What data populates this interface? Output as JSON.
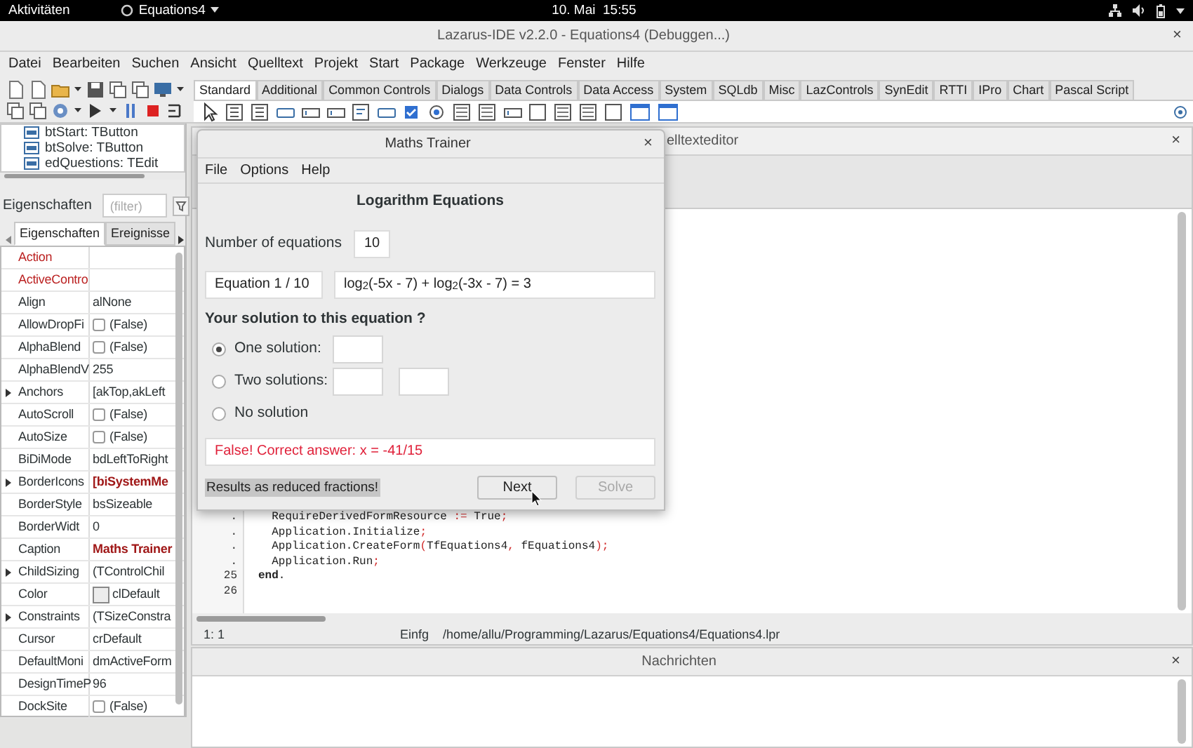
{
  "top_bar": {
    "activities": "Aktivitäten",
    "app_menu": "Equations4",
    "clock": "10. Mai  15:55"
  },
  "ide": {
    "title": "Lazarus-IDE v2.2.0 - Equations4 (Debuggen...)",
    "close": "×",
    "menu": [
      "Datei",
      "Bearbeiten",
      "Suchen",
      "Ansicht",
      "Quelltext",
      "Projekt",
      "Start",
      "Package",
      "Werkzeuge",
      "Fenster",
      "Hilfe"
    ],
    "palette_tabs": [
      {
        "label": "Standard",
        "selected": true
      },
      {
        "label": "Additional",
        "selected": false
      },
      {
        "label": "Common Controls",
        "selected": false
      },
      {
        "label": "Dialogs",
        "selected": false
      },
      {
        "label": "Data Controls",
        "selected": false
      },
      {
        "label": "Data Access",
        "selected": false
      },
      {
        "label": "System",
        "selected": false
      },
      {
        "label": "SQLdb",
        "selected": false
      },
      {
        "label": "Misc",
        "selected": false
      },
      {
        "label": "LazControls",
        "selected": false
      },
      {
        "label": "SynEdit",
        "selected": false
      },
      {
        "label": "RTTI",
        "selected": false
      },
      {
        "label": "IPro",
        "selected": false
      },
      {
        "label": "Chart",
        "selected": false
      },
      {
        "label": "Pascal Script",
        "selected": false
      }
    ]
  },
  "object_inspector": {
    "tree": [
      "btStart: TButton",
      "btSolve: TButton",
      "edQuestions: TEdit"
    ],
    "filter_label": "Eigenschaften",
    "filter_placeholder": "(filter)",
    "tabs": [
      {
        "label": "Eigenschaften",
        "selected": true
      },
      {
        "label": "Ereignisse",
        "selected": false
      }
    ],
    "properties": [
      {
        "name": "Action",
        "kind": "text",
        "highlight": true
      },
      {
        "name": "ActiveContro",
        "kind": "text",
        "highlight": true
      },
      {
        "name": "Align",
        "value": "alNone",
        "kind": "text"
      },
      {
        "name": "AllowDropFi",
        "value": "(False)",
        "kind": "checkbox",
        "checked": false
      },
      {
        "name": "AlphaBlend",
        "value": "(False)",
        "kind": "checkbox",
        "checked": false
      },
      {
        "name": "AlphaBlendV",
        "value": "255",
        "kind": "text"
      },
      {
        "name": "Anchors",
        "value": "[akTop,akLeft",
        "kind": "text",
        "expandable": true
      },
      {
        "name": "AutoScroll",
        "value": "(False)",
        "kind": "checkbox",
        "checked": false
      },
      {
        "name": "AutoSize",
        "value": "(False)",
        "kind": "checkbox",
        "checked": false
      },
      {
        "name": "BiDiMode",
        "value": "bdLeftToRight",
        "kind": "text"
      },
      {
        "name": "BorderIcons",
        "value": "[biSystemMe",
        "kind": "text",
        "expandable": true,
        "modified": true
      },
      {
        "name": "BorderStyle",
        "value": "bsSizeable",
        "kind": "text"
      },
      {
        "name": "BorderWidt",
        "value": "0",
        "kind": "text"
      },
      {
        "name": "Caption",
        "value": "Maths Trainer",
        "kind": "text",
        "modified": true
      },
      {
        "name": "ChildSizing",
        "value": "(TControlChil",
        "kind": "text",
        "expandable": true
      },
      {
        "name": "Color",
        "value": "clDefault",
        "kind": "color"
      },
      {
        "name": "Constraints",
        "value": "(TSizeConstra",
        "kind": "text",
        "expandable": true
      },
      {
        "name": "Cursor",
        "value": "crDefault",
        "kind": "text"
      },
      {
        "name": "DefaultMoni",
        "value": "dmActiveForm",
        "kind": "text"
      },
      {
        "name": "DesignTimeP",
        "value": "96",
        "kind": "text"
      },
      {
        "name": "DockSite",
        "value": "(False)",
        "kind": "checkbox",
        "checked": false
      }
    ]
  },
  "source_editor": {
    "title": "elltexteditor",
    "lines": [
      {
        "gutter": ".",
        "tokens": [
          {
            "text": "  RequireDerivedFormResource ",
            "kind": "ident"
          },
          {
            "text": ":=",
            "kind": "symbol"
          },
          {
            "text": " True",
            "kind": "ident"
          },
          {
            "text": ";",
            "kind": "symbol"
          }
        ]
      },
      {
        "gutter": ".",
        "tokens": [
          {
            "text": "  Application.Initialize",
            "kind": "ident"
          },
          {
            "text": ";",
            "kind": "symbol"
          }
        ]
      },
      {
        "gutter": ".",
        "tokens": [
          {
            "text": "  Application.CreateForm",
            "kind": "ident"
          },
          {
            "text": "(",
            "kind": "symbol"
          },
          {
            "text": "TfEquations4",
            "kind": "ident"
          },
          {
            "text": ",",
            "kind": "symbol"
          },
          {
            "text": " fEquations4",
            "kind": "ident"
          },
          {
            "text": ");",
            "kind": "symbol"
          }
        ]
      },
      {
        "gutter": ".",
        "tokens": [
          {
            "text": "  Application.Run",
            "kind": "ident"
          },
          {
            "text": ";",
            "kind": "symbol"
          }
        ]
      },
      {
        "gutter": "25",
        "tokens": [
          {
            "text": "end",
            "kind": "keyword"
          },
          {
            "text": ".",
            "kind": "ident"
          }
        ]
      },
      {
        "gutter": "26"
      }
    ],
    "close": "×",
    "status": {
      "position": "1: 1",
      "mode": "Einfg",
      "file": "/home/allu/Programming/Lazarus/Equations4/Equations4.lpr"
    }
  },
  "messages": {
    "title": "Nachrichten",
    "close": "×"
  },
  "dialog": {
    "title": "Maths Trainer",
    "close": "×",
    "menu": [
      "File",
      "Options",
      "Help"
    ],
    "heading": "Logarithm Equations",
    "count_label": "Number of equations",
    "count_value": "10",
    "equation_label": "Equation 1 / 10",
    "equation": "log$_{2}$(-5x - 7) + log$_{2}$(-3x - 7) = 3",
    "question": "Your solution to this equation ?",
    "options": [
      {
        "label": "One solution:",
        "selected": true,
        "kind": "one_field"
      },
      {
        "label": "Two solutions:",
        "selected": false,
        "kind": "two_fields"
      },
      {
        "label": "No solution",
        "selected": false,
        "kind": "no_field"
      }
    ],
    "result": "False! Correct answer: x = -41/15",
    "result_correct": false,
    "hint": "Results as reduced fractions!",
    "buttons": [
      {
        "label": "Next",
        "disabled": false
      },
      {
        "label": "Solve",
        "disabled": true
      }
    ]
  }
}
